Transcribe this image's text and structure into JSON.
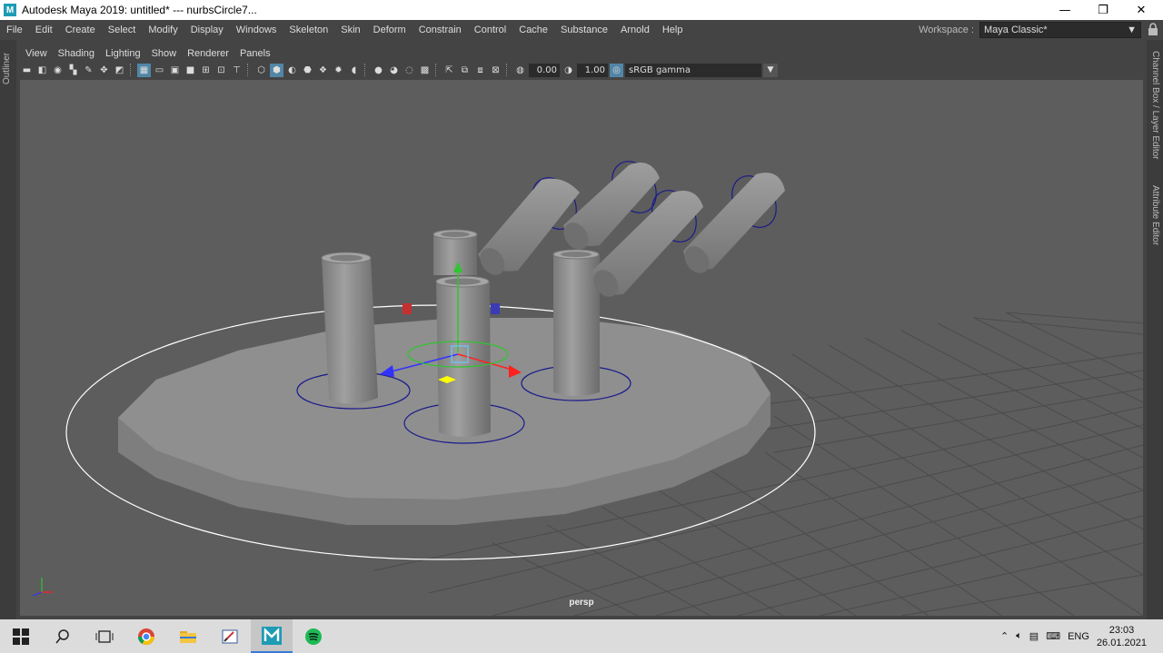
{
  "window": {
    "title": "Autodesk Maya 2019: untitled*   ---   nurbsCircle7...",
    "logo": "M",
    "controls": {
      "minimize": "—",
      "maximize": "❐",
      "close": "✕"
    }
  },
  "menubar": {
    "items": [
      "File",
      "Edit",
      "Create",
      "Select",
      "Modify",
      "Display",
      "Windows",
      "Skeleton",
      "Skin",
      "Deform",
      "Constrain",
      "Control",
      "Cache",
      "Substance",
      "Arnold",
      "Help"
    ],
    "workspace_label": "Workspace :",
    "workspace_value": "Maya Classic*"
  },
  "side_panels": {
    "left": "Outliner",
    "right_top": "Channel Box / Layer Editor",
    "right_bottom": "Attribute Editor"
  },
  "panel_menu": [
    "View",
    "Shading",
    "Lighting",
    "Show",
    "Renderer",
    "Panels"
  ],
  "toolbar": {
    "exposure": "0.00",
    "gamma": "1.00",
    "color_space": "sRGB gamma"
  },
  "viewport": {
    "camera": "persp",
    "colors": {
      "background": "#5d5d5d",
      "grid": "#4a4a4a",
      "mesh": "#8c8c8c",
      "nurbs_curve": "#1a1a8c",
      "selected_curve": "#ffffff"
    }
  },
  "taskbar": {
    "apps": [
      "windows-start-icon",
      "search-icon",
      "task-view-icon",
      "chrome-icon",
      "file-explorer-icon",
      "paint-icon",
      "maya-icon",
      "spotify-icon"
    ],
    "language": "ENG",
    "time": "23:03",
    "date": "26.01.2021"
  }
}
